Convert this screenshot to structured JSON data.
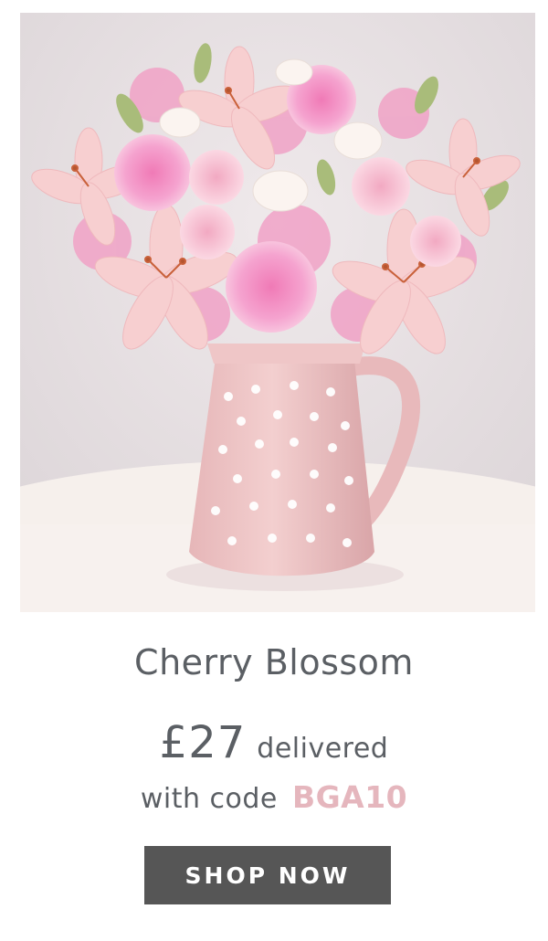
{
  "product": {
    "image_alt": "Pink lilies and carnations in a polka dot jug",
    "name": "Cherry Blossom",
    "price": "£27",
    "price_suffix": "delivered",
    "code_prefix": "with code",
    "code": "BGA10"
  },
  "cta": {
    "label": "SHOP NOW"
  },
  "colors": {
    "cta_background": "#565656",
    "code_accent": "#e5b6bd",
    "text": "#5b5f64"
  }
}
